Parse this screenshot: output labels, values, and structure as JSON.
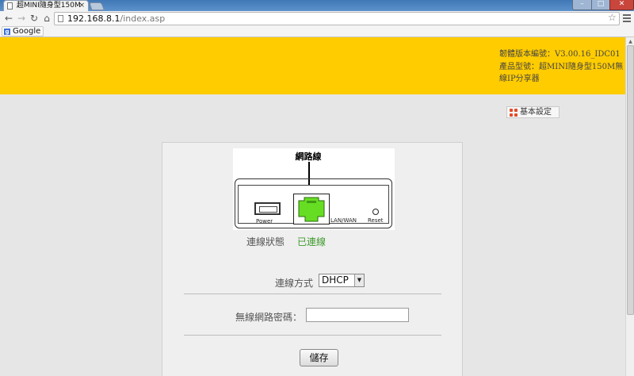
{
  "browser": {
    "tab_title": "超MINI隨身型150M",
    "tab_close": "×",
    "url_host": "192.168.8.1",
    "url_path": "/index.asp",
    "window_min": "–",
    "window_max": "□",
    "window_close": "✕",
    "bookmark_google": "Google",
    "icons": [
      "back-arrow-icon",
      "forward-arrow-icon",
      "reload-icon",
      "home-icon",
      "star-icon",
      "menu-icon"
    ]
  },
  "header": {
    "background": "#ffcc00",
    "firmware": "韌體版本編號：V3.00.16_IDC01",
    "model": "產品型號：超MINI隨身型150M無線IP分享器"
  },
  "basic_settings": {
    "label": "基本設定"
  },
  "router_diagram": {
    "cable_label": "網路線",
    "power_label": "Power",
    "lan_label": "LAN/WAN",
    "reset_label": "Reset",
    "port_color": "#66dd22"
  },
  "status": {
    "label": "連線狀態",
    "value": "已連線",
    "value_color": "#3f9a2c"
  },
  "connection": {
    "label": "連線方式",
    "selected": "DHCP"
  },
  "wireless": {
    "password_label": "無線網路密碼：",
    "password_value": ""
  },
  "save": {
    "label": "儲存"
  }
}
